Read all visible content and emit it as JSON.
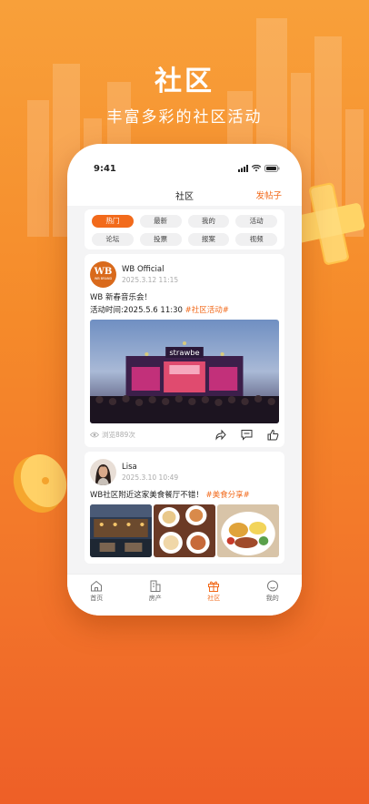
{
  "hero": {
    "title": "社区",
    "subtitle": "丰富多彩的社区活动"
  },
  "status_bar": {
    "time": "9:41"
  },
  "header": {
    "title": "社区",
    "post_button": "发帖子"
  },
  "categories": [
    {
      "label": "热门",
      "active": true
    },
    {
      "label": "最新"
    },
    {
      "label": "我的"
    },
    {
      "label": "活动"
    },
    {
      "label": "论坛"
    },
    {
      "label": "投票"
    },
    {
      "label": "报案"
    },
    {
      "label": "视频"
    }
  ],
  "posts": [
    {
      "author": "WB Official",
      "avatar_text": "WB",
      "avatar_sub": "WB BRAND",
      "datetime": "2025.3.12  11:15",
      "line1": "WB 新春音乐会！",
      "line2": "活动时间:2025.5.6  11:30",
      "tag": "#社区活动#",
      "stage_text": "strawbe",
      "views": "浏览889次"
    },
    {
      "author": "Lisa",
      "datetime": "2025.3.10  10:49",
      "text": "WB社区附近这家美食餐厅不错！",
      "tag": "#美食分享#"
    }
  ],
  "tabbar": [
    {
      "label": "首页",
      "icon": "home-icon"
    },
    {
      "label": "房产",
      "icon": "building-icon"
    },
    {
      "label": "社区",
      "icon": "gift-icon",
      "active": true
    },
    {
      "label": "我的",
      "icon": "profile-icon"
    }
  ],
  "colors": {
    "accent": "#f26a1b",
    "bg_top": "#f8a03a",
    "bg_bottom": "#ee5f27"
  }
}
